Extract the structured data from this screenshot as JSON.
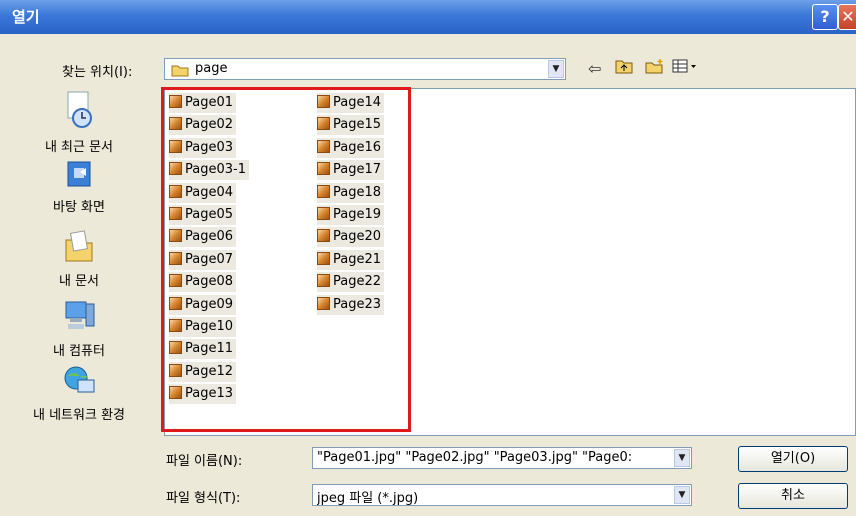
{
  "window": {
    "title": "열기"
  },
  "lookin": {
    "label": "찾는 위치(I):",
    "value": "page"
  },
  "places": [
    {
      "label": "내 최근 문서",
      "icon": "recent-documents-icon"
    },
    {
      "label": "바탕 화면",
      "icon": "desktop-icon"
    },
    {
      "label": "내 문서",
      "icon": "my-documents-icon"
    },
    {
      "label": "내 컴퓨터",
      "icon": "my-computer-icon"
    },
    {
      "label": "내 네트워크 환경",
      "icon": "network-places-icon"
    }
  ],
  "files": [
    "Page01",
    "Page02",
    "Page03",
    "Page03-1",
    "Page04",
    "Page05",
    "Page06",
    "Page07",
    "Page08",
    "Page09",
    "Page10",
    "Page11",
    "Page12",
    "Page13",
    "Page14",
    "Page15",
    "Page16",
    "Page17",
    "Page18",
    "Page19",
    "Page20",
    "Page21",
    "Page22",
    "Page23"
  ],
  "filename": {
    "label": "파일 이름(N):",
    "value": "\"Page01.jpg\" \"Page02.jpg\" \"Page03.jpg\" \"Page0:"
  },
  "filetype": {
    "label": "파일 형식(T):",
    "value": "jpeg 파일 (*.jpg)"
  },
  "buttons": {
    "open": "열기(O)",
    "cancel": "취소"
  },
  "highlight_color": "#e01a1a"
}
